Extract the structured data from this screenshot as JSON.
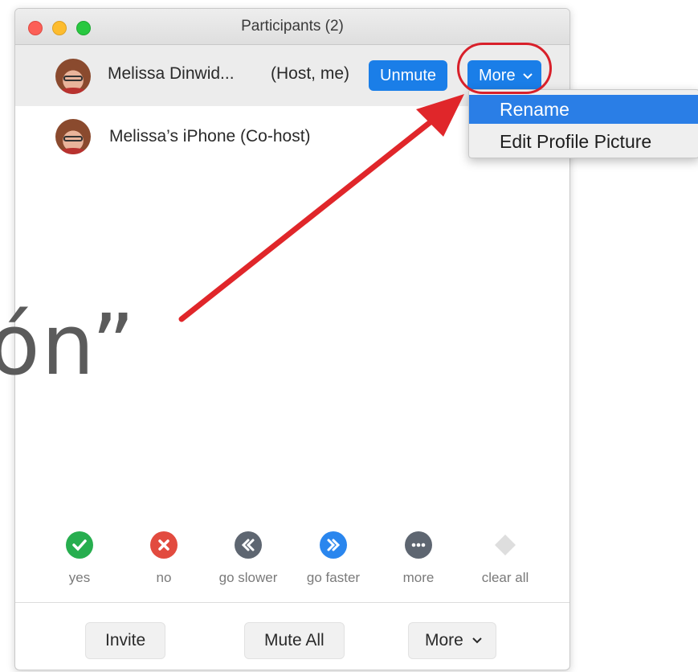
{
  "window": {
    "title": "Participants (2)"
  },
  "participants": [
    {
      "name": "Melissa Dinwid...",
      "role": "(Host, me)",
      "unmute_label": "Unmute",
      "more_label": "More"
    },
    {
      "name": "Melissa’s iPhone (Co-host)"
    }
  ],
  "dropdown": {
    "items": [
      "Rename",
      "Edit Profile Picture"
    ]
  },
  "overlay_text": "ón”",
  "reactions": [
    {
      "label": "yes",
      "icon": "check-icon",
      "color": "#27ae4f"
    },
    {
      "label": "no",
      "icon": "x-icon",
      "color": "#e24b3f"
    },
    {
      "label": "go slower",
      "icon": "rewind-icon",
      "color": "#5e6671"
    },
    {
      "label": "go faster",
      "icon": "fast-forward-icon",
      "color": "#2a86ee"
    },
    {
      "label": "more",
      "icon": "ellipsis-icon",
      "color": "#5e6671"
    },
    {
      "label": "clear all",
      "icon": "diamond-icon",
      "color": "#d9d9d9"
    }
  ],
  "footer": {
    "invite": "Invite",
    "mute_all": "Mute All",
    "more": "More"
  },
  "colors": {
    "accent": "#1a7ee8",
    "highlight": "#2a7ee6",
    "annotation": "#d8202a"
  }
}
